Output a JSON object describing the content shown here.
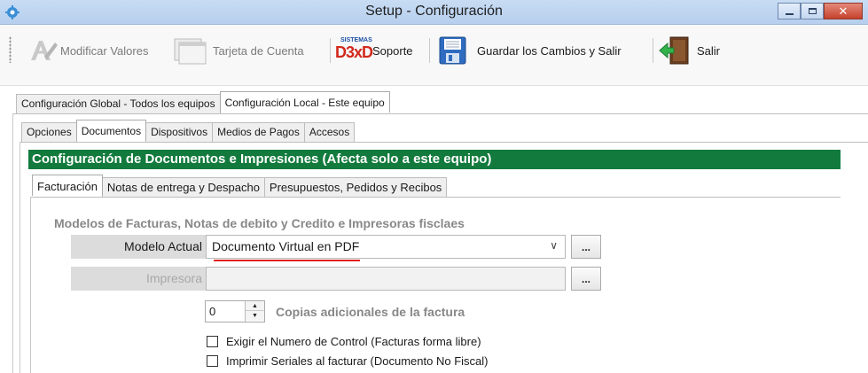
{
  "window": {
    "title": "Setup - Configuración"
  },
  "toolbar": {
    "modify_label": "Modificar Valores",
    "card_label": "Tarjeta de Cuenta",
    "support_logo_top": "SISTEMAS",
    "support_logo_main": "D3xD",
    "support_label": "Soporte",
    "save_label": "Guardar los Cambios  y Salir",
    "exit_label": "Salir"
  },
  "top_tabs": [
    "Configuración Global - Todos los equipos",
    "Configuración Local - Este equipo"
  ],
  "second_tabs": [
    "Opciones",
    "Documentos",
    "Dispositivos",
    "Medios de Pagos",
    "Accesos"
  ],
  "header": {
    "title": "Configuración de Documentos e Impresiones (Afecta solo a este equipo)"
  },
  "inner_tabs": [
    "Facturación",
    "Notas de entrega y Despacho",
    "Presupuestos, Pedidos y Recibos"
  ],
  "section": {
    "title": "Modelos de Facturas, Notas de debito y Credito e Impresoras fisclaes"
  },
  "model": {
    "label": "Modelo Actual",
    "value": "Documento Virtual en PDF",
    "button": "..."
  },
  "printer": {
    "label": "Impresora",
    "value": "",
    "button": "..."
  },
  "copies": {
    "value": "0",
    "label": "Copias adicionales de la factura"
  },
  "checkboxes": [
    {
      "label": "Exigir el Numero de Control (Facturas forma libre)",
      "checked": false
    },
    {
      "label": "Imprimir  Seriales al facturar (Documento No Fiscal)",
      "checked": false
    }
  ],
  "colors": {
    "header_bg": "#117a3c",
    "accent_underline": "#e02020"
  }
}
